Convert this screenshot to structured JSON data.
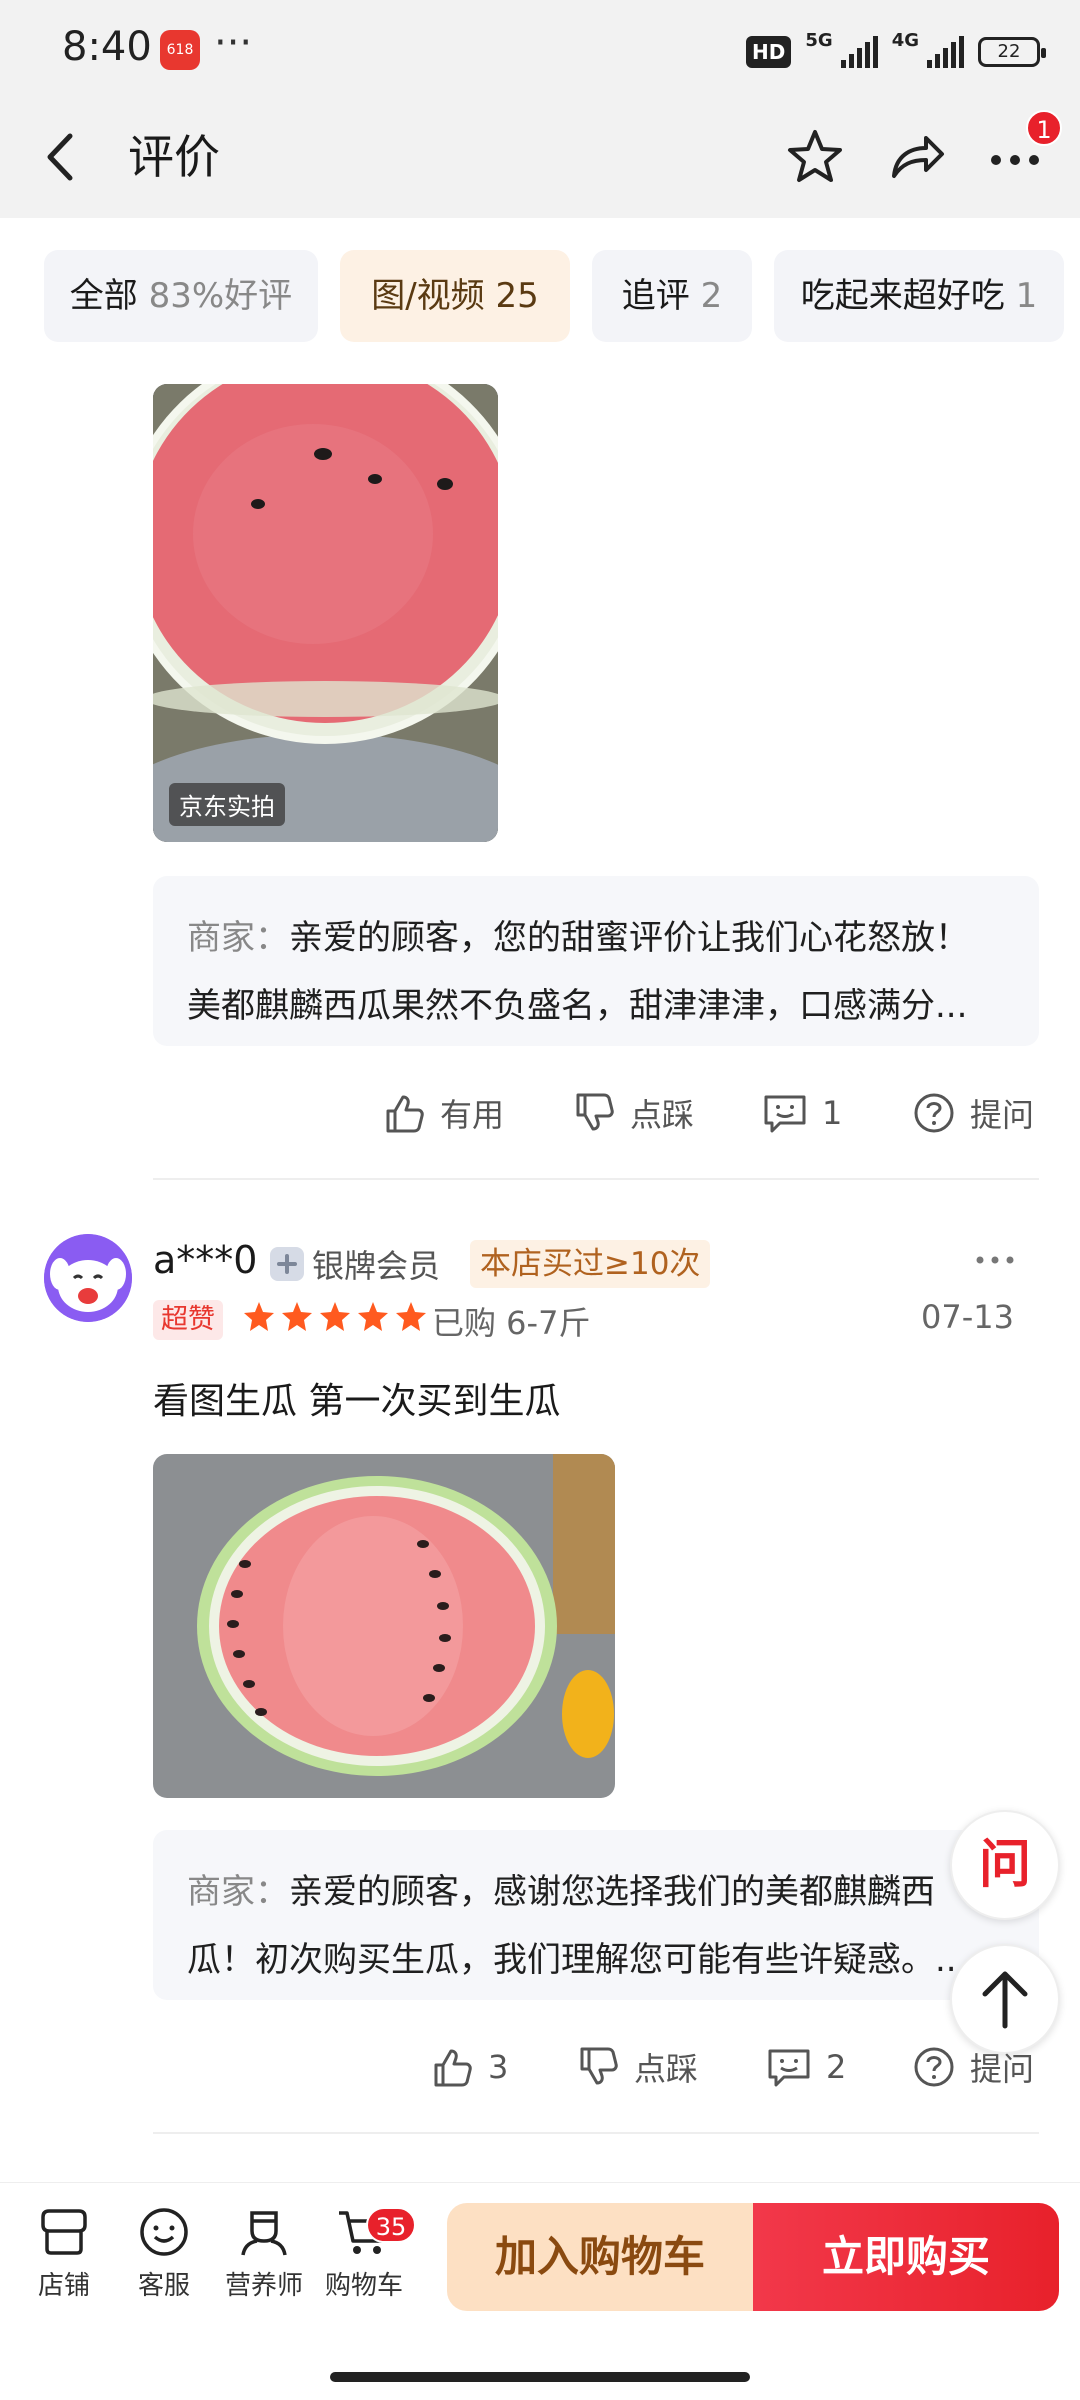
{
  "status_bar": {
    "time": "8:40",
    "app_badge": "618",
    "more": "···",
    "hd": "HD",
    "net_5g": "5G",
    "net_4g": "4G",
    "battery": "22"
  },
  "nav": {
    "title": "评价",
    "more_badge": "1"
  },
  "filters": [
    {
      "label": "全部",
      "count": "83%好评"
    },
    {
      "label": "图/视频",
      "count": "25"
    },
    {
      "label": "追评",
      "count": "2"
    },
    {
      "label": "吃起来超好吃",
      "count": "1"
    }
  ],
  "review1": {
    "photo_tag": "京东实拍",
    "reply_label": "商家：",
    "reply_line1": "亲爱的顾客，您的甜蜜评价让我们心花怒放！",
    "reply_line2": "美都麒麟西瓜果然不负盛名，甜津津津，口感满分...",
    "useful": "有用",
    "dislike": "点踩",
    "comments": "1",
    "ask": "提问"
  },
  "review2": {
    "user": "a***0",
    "member": "银牌会员",
    "member_icon": "plus",
    "repeat": "本店买过≥10次",
    "super": "超赞",
    "rating": 5,
    "bought": "已购 6-7斤",
    "date": "07-13",
    "text": "看图生瓜 第一次买到生瓜",
    "reply_label": "商家：",
    "reply_line1": "亲爱的顾客，感谢您选择我们的美都麒麟西",
    "reply_line2": "瓜！初次购买生瓜，我们理解您可能有些许疑惑。..",
    "useful_count": "3",
    "dislike": "点踩",
    "comments": "2",
    "ask": "提问"
  },
  "float": {
    "ask_label": "问"
  },
  "bottom": {
    "store": "店铺",
    "service": "客服",
    "nutritionist": "营养师",
    "cart": "购物车",
    "cart_count": "35",
    "add_cart": "加入购物车",
    "buy_now": "立即购买"
  },
  "colors": {
    "accent_red": "#e8212b",
    "chip_active_bg": "#fdf1e4",
    "star": "#ff5a1f"
  }
}
